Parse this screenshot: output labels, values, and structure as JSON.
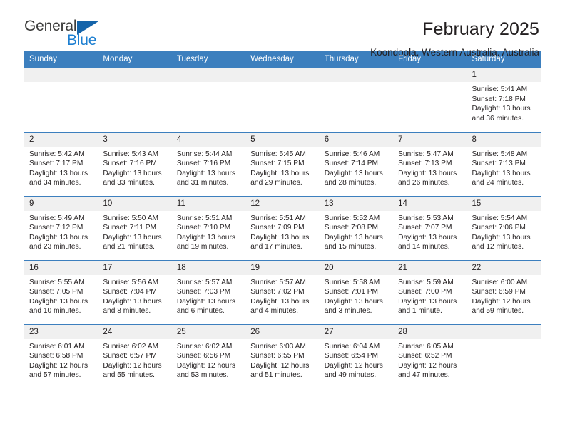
{
  "brand": {
    "name_top": "General",
    "name_bottom": "Blue",
    "triangle_color": "#1464aa",
    "blue_text_color": "#1d7fd1"
  },
  "header": {
    "title": "February 2025",
    "subtitle": "Koondoola, Western Australia, Australia"
  },
  "calendar": {
    "header_bg": "#3c7fbe",
    "daynum_bg": "#f0f0f0",
    "weekday_names": [
      "Sunday",
      "Monday",
      "Tuesday",
      "Wednesday",
      "Thursday",
      "Friday",
      "Saturday"
    ],
    "labels": {
      "sunrise": "Sunrise:",
      "sunset": "Sunset:",
      "daylight": "Daylight:"
    },
    "weeks": [
      [
        {
          "day": ""
        },
        {
          "day": ""
        },
        {
          "day": ""
        },
        {
          "day": ""
        },
        {
          "day": ""
        },
        {
          "day": ""
        },
        {
          "day": "1",
          "sunrise": "Sunrise: 5:41 AM",
          "sunset": "Sunset: 7:18 PM",
          "daylight_1": "Daylight: 13 hours",
          "daylight_2": "and 36 minutes."
        }
      ],
      [
        {
          "day": "2",
          "sunrise": "Sunrise: 5:42 AM",
          "sunset": "Sunset: 7:17 PM",
          "daylight_1": "Daylight: 13 hours",
          "daylight_2": "and 34 minutes."
        },
        {
          "day": "3",
          "sunrise": "Sunrise: 5:43 AM",
          "sunset": "Sunset: 7:16 PM",
          "daylight_1": "Daylight: 13 hours",
          "daylight_2": "and 33 minutes."
        },
        {
          "day": "4",
          "sunrise": "Sunrise: 5:44 AM",
          "sunset": "Sunset: 7:16 PM",
          "daylight_1": "Daylight: 13 hours",
          "daylight_2": "and 31 minutes."
        },
        {
          "day": "5",
          "sunrise": "Sunrise: 5:45 AM",
          "sunset": "Sunset: 7:15 PM",
          "daylight_1": "Daylight: 13 hours",
          "daylight_2": "and 29 minutes."
        },
        {
          "day": "6",
          "sunrise": "Sunrise: 5:46 AM",
          "sunset": "Sunset: 7:14 PM",
          "daylight_1": "Daylight: 13 hours",
          "daylight_2": "and 28 minutes."
        },
        {
          "day": "7",
          "sunrise": "Sunrise: 5:47 AM",
          "sunset": "Sunset: 7:13 PM",
          "daylight_1": "Daylight: 13 hours",
          "daylight_2": "and 26 minutes."
        },
        {
          "day": "8",
          "sunrise": "Sunrise: 5:48 AM",
          "sunset": "Sunset: 7:13 PM",
          "daylight_1": "Daylight: 13 hours",
          "daylight_2": "and 24 minutes."
        }
      ],
      [
        {
          "day": "9",
          "sunrise": "Sunrise: 5:49 AM",
          "sunset": "Sunset: 7:12 PM",
          "daylight_1": "Daylight: 13 hours",
          "daylight_2": "and 23 minutes."
        },
        {
          "day": "10",
          "sunrise": "Sunrise: 5:50 AM",
          "sunset": "Sunset: 7:11 PM",
          "daylight_1": "Daylight: 13 hours",
          "daylight_2": "and 21 minutes."
        },
        {
          "day": "11",
          "sunrise": "Sunrise: 5:51 AM",
          "sunset": "Sunset: 7:10 PM",
          "daylight_1": "Daylight: 13 hours",
          "daylight_2": "and 19 minutes."
        },
        {
          "day": "12",
          "sunrise": "Sunrise: 5:51 AM",
          "sunset": "Sunset: 7:09 PM",
          "daylight_1": "Daylight: 13 hours",
          "daylight_2": "and 17 minutes."
        },
        {
          "day": "13",
          "sunrise": "Sunrise: 5:52 AM",
          "sunset": "Sunset: 7:08 PM",
          "daylight_1": "Daylight: 13 hours",
          "daylight_2": "and 15 minutes."
        },
        {
          "day": "14",
          "sunrise": "Sunrise: 5:53 AM",
          "sunset": "Sunset: 7:07 PM",
          "daylight_1": "Daylight: 13 hours",
          "daylight_2": "and 14 minutes."
        },
        {
          "day": "15",
          "sunrise": "Sunrise: 5:54 AM",
          "sunset": "Sunset: 7:06 PM",
          "daylight_1": "Daylight: 13 hours",
          "daylight_2": "and 12 minutes."
        }
      ],
      [
        {
          "day": "16",
          "sunrise": "Sunrise: 5:55 AM",
          "sunset": "Sunset: 7:05 PM",
          "daylight_1": "Daylight: 13 hours",
          "daylight_2": "and 10 minutes."
        },
        {
          "day": "17",
          "sunrise": "Sunrise: 5:56 AM",
          "sunset": "Sunset: 7:04 PM",
          "daylight_1": "Daylight: 13 hours",
          "daylight_2": "and 8 minutes."
        },
        {
          "day": "18",
          "sunrise": "Sunrise: 5:57 AM",
          "sunset": "Sunset: 7:03 PM",
          "daylight_1": "Daylight: 13 hours",
          "daylight_2": "and 6 minutes."
        },
        {
          "day": "19",
          "sunrise": "Sunrise: 5:57 AM",
          "sunset": "Sunset: 7:02 PM",
          "daylight_1": "Daylight: 13 hours",
          "daylight_2": "and 4 minutes."
        },
        {
          "day": "20",
          "sunrise": "Sunrise: 5:58 AM",
          "sunset": "Sunset: 7:01 PM",
          "daylight_1": "Daylight: 13 hours",
          "daylight_2": "and 3 minutes."
        },
        {
          "day": "21",
          "sunrise": "Sunrise: 5:59 AM",
          "sunset": "Sunset: 7:00 PM",
          "daylight_1": "Daylight: 13 hours",
          "daylight_2": "and 1 minute."
        },
        {
          "day": "22",
          "sunrise": "Sunrise: 6:00 AM",
          "sunset": "Sunset: 6:59 PM",
          "daylight_1": "Daylight: 12 hours",
          "daylight_2": "and 59 minutes."
        }
      ],
      [
        {
          "day": "23",
          "sunrise": "Sunrise: 6:01 AM",
          "sunset": "Sunset: 6:58 PM",
          "daylight_1": "Daylight: 12 hours",
          "daylight_2": "and 57 minutes."
        },
        {
          "day": "24",
          "sunrise": "Sunrise: 6:02 AM",
          "sunset": "Sunset: 6:57 PM",
          "daylight_1": "Daylight: 12 hours",
          "daylight_2": "and 55 minutes."
        },
        {
          "day": "25",
          "sunrise": "Sunrise: 6:02 AM",
          "sunset": "Sunset: 6:56 PM",
          "daylight_1": "Daylight: 12 hours",
          "daylight_2": "and 53 minutes."
        },
        {
          "day": "26",
          "sunrise": "Sunrise: 6:03 AM",
          "sunset": "Sunset: 6:55 PM",
          "daylight_1": "Daylight: 12 hours",
          "daylight_2": "and 51 minutes."
        },
        {
          "day": "27",
          "sunrise": "Sunrise: 6:04 AM",
          "sunset": "Sunset: 6:54 PM",
          "daylight_1": "Daylight: 12 hours",
          "daylight_2": "and 49 minutes."
        },
        {
          "day": "28",
          "sunrise": "Sunrise: 6:05 AM",
          "sunset": "Sunset: 6:52 PM",
          "daylight_1": "Daylight: 12 hours",
          "daylight_2": "and 47 minutes."
        },
        {
          "day": ""
        }
      ]
    ]
  }
}
